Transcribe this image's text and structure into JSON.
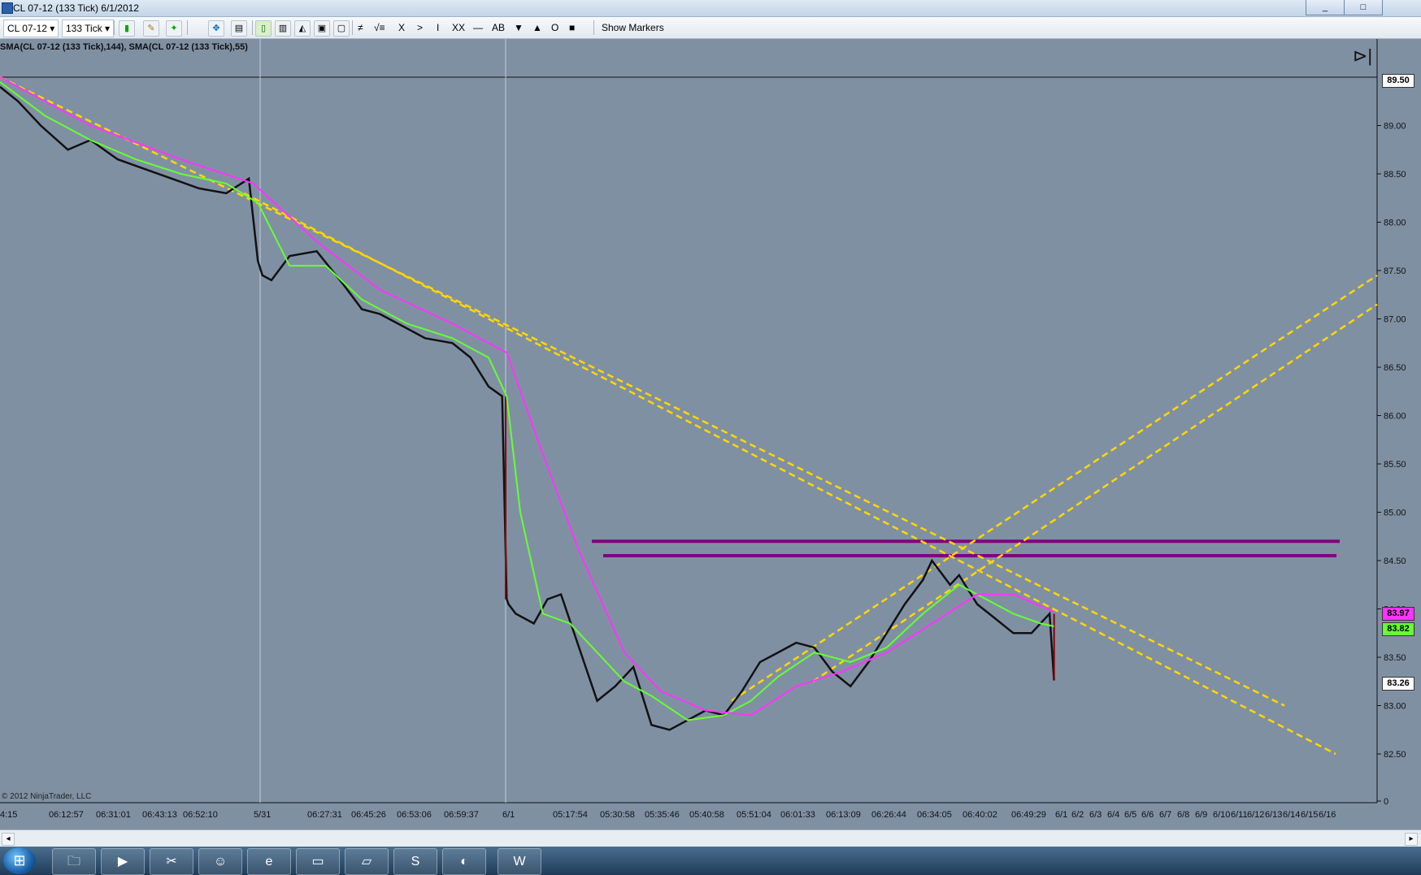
{
  "window": {
    "title": "CL 07-12 (133 Tick)  6/1/2012",
    "min_label": "_",
    "max_label": "□",
    "close_label": "✕"
  },
  "toolbar": {
    "instrument": "CL 07-12",
    "interval": "133 Tick",
    "show_markers": "Show Markers",
    "tools": [
      "≠",
      "√≡",
      "X",
      ">",
      "I",
      "XX",
      "—",
      "AB",
      "▼",
      "▲",
      "O",
      "■"
    ]
  },
  "legend": "SMA(CL 07-12 (133 Tick),144),  SMA(CL 07-12 (133 Tick),55)",
  "watermark": "© 2012 NinjaTrader, LLC",
  "price_tags": {
    "top": "89.50",
    "sma144": "83.97",
    "sma55": "83.82",
    "last": "83.26"
  },
  "colors": {
    "background": "#8090a3",
    "sma144": "#ff33ff",
    "sma55": "#66ff33",
    "trendline": "#ffd700",
    "horizontal": "#800080",
    "price": "#111111",
    "down_candle": "#8b0000"
  },
  "chart_data": {
    "type": "line",
    "ylim": [
      82.0,
      89.5
    ],
    "y_ticks": [
      "89.00",
      "88.50",
      "88.00",
      "87.50",
      "87.00",
      "86.50",
      "86.00",
      "85.50",
      "85.00",
      "84.50",
      "84.00",
      "83.50",
      "83.00",
      "82.50",
      "0"
    ],
    "x_tick_labels": [
      "4:15",
      "06:12:57",
      "06:31:01",
      "06:43:13",
      "06:52:10",
      "5/31",
      "06:27:31",
      "06:45:26",
      "06:53:06",
      "06:59:37",
      "6/1",
      "05:17:54",
      "05:30:58",
      "05:35:46",
      "05:40:58",
      "05:51:04",
      "06:01:33",
      "06:13:09",
      "06:26:44",
      "06:34:05",
      "06:40:02",
      "06:49:29",
      "6/1",
      "6/2",
      "6/3",
      "6/4",
      "6/5",
      "6/6",
      "6/7",
      "6/8",
      "6/9",
      "6/10",
      "6/11",
      "6/12",
      "6/13",
      "6/14",
      "6/15",
      "6/16"
    ],
    "series": [
      {
        "kind": "price",
        "x": [
          0,
          20,
          45,
          75,
          100,
          130,
          160,
          190,
          220,
          250,
          275,
          285,
          290,
          300,
          320,
          350,
          380,
          400,
          420,
          450,
          470,
          500,
          520,
          540,
          555,
          560,
          562,
          570,
          590,
          605,
          620,
          640,
          660,
          680,
          700,
          720,
          740,
          760,
          780,
          800,
          820,
          840,
          860,
          880,
          900,
          920,
          940,
          960,
          980,
          1000,
          1020,
          1030,
          1050,
          1060,
          1080,
          1100,
          1120,
          1140,
          1160,
          1165
        ],
        "values": [
          89.4,
          89.25,
          89.0,
          88.75,
          88.85,
          88.65,
          88.55,
          88.45,
          88.35,
          88.3,
          88.45,
          87.6,
          87.45,
          87.4,
          87.65,
          87.7,
          87.35,
          87.1,
          87.05,
          86.9,
          86.8,
          86.75,
          86.6,
          86.3,
          86.2,
          84.1,
          84.05,
          83.95,
          83.85,
          84.1,
          84.15,
          83.6,
          83.05,
          83.2,
          83.4,
          82.8,
          82.75,
          82.85,
          82.95,
          82.9,
          83.15,
          83.45,
          83.55,
          83.65,
          83.6,
          83.35,
          83.2,
          83.45,
          83.75,
          84.05,
          84.3,
          84.5,
          84.25,
          84.35,
          84.05,
          83.9,
          83.75,
          83.75,
          83.95,
          83.26
        ]
      },
      {
        "name": "SMA(CL 07-12 (133 Tick),55)",
        "x": [
          0,
          50,
          100,
          150,
          200,
          250,
          285,
          320,
          360,
          400,
          450,
          500,
          540,
          560,
          575,
          600,
          630,
          660,
          690,
          720,
          760,
          800,
          830,
          860,
          900,
          940,
          980,
          1020,
          1060,
          1090,
          1120,
          1150,
          1165
        ],
        "values": [
          89.45,
          89.1,
          88.85,
          88.65,
          88.5,
          88.4,
          88.2,
          87.55,
          87.55,
          87.2,
          86.95,
          86.8,
          86.6,
          86.2,
          85.0,
          83.95,
          83.85,
          83.55,
          83.25,
          83.1,
          82.85,
          82.9,
          83.05,
          83.3,
          83.55,
          83.45,
          83.6,
          83.95,
          84.25,
          84.1,
          83.95,
          83.85,
          83.82
        ]
      },
      {
        "name": "SMA(CL 07-12 (133 Tick),144)",
        "x": [
          0,
          100,
          200,
          280,
          350,
          420,
          500,
          560,
          600,
          640,
          690,
          730,
          780,
          830,
          880,
          930,
          980,
          1030,
          1080,
          1120,
          1165
        ],
        "values": [
          89.5,
          89.0,
          88.65,
          88.4,
          87.8,
          87.3,
          86.95,
          86.65,
          85.6,
          84.6,
          83.55,
          83.15,
          82.95,
          82.9,
          83.2,
          83.35,
          83.55,
          83.85,
          84.15,
          84.15,
          83.97
        ]
      }
    ],
    "horizontal_lines": [
      84.7,
      84.55
    ]
  }
}
